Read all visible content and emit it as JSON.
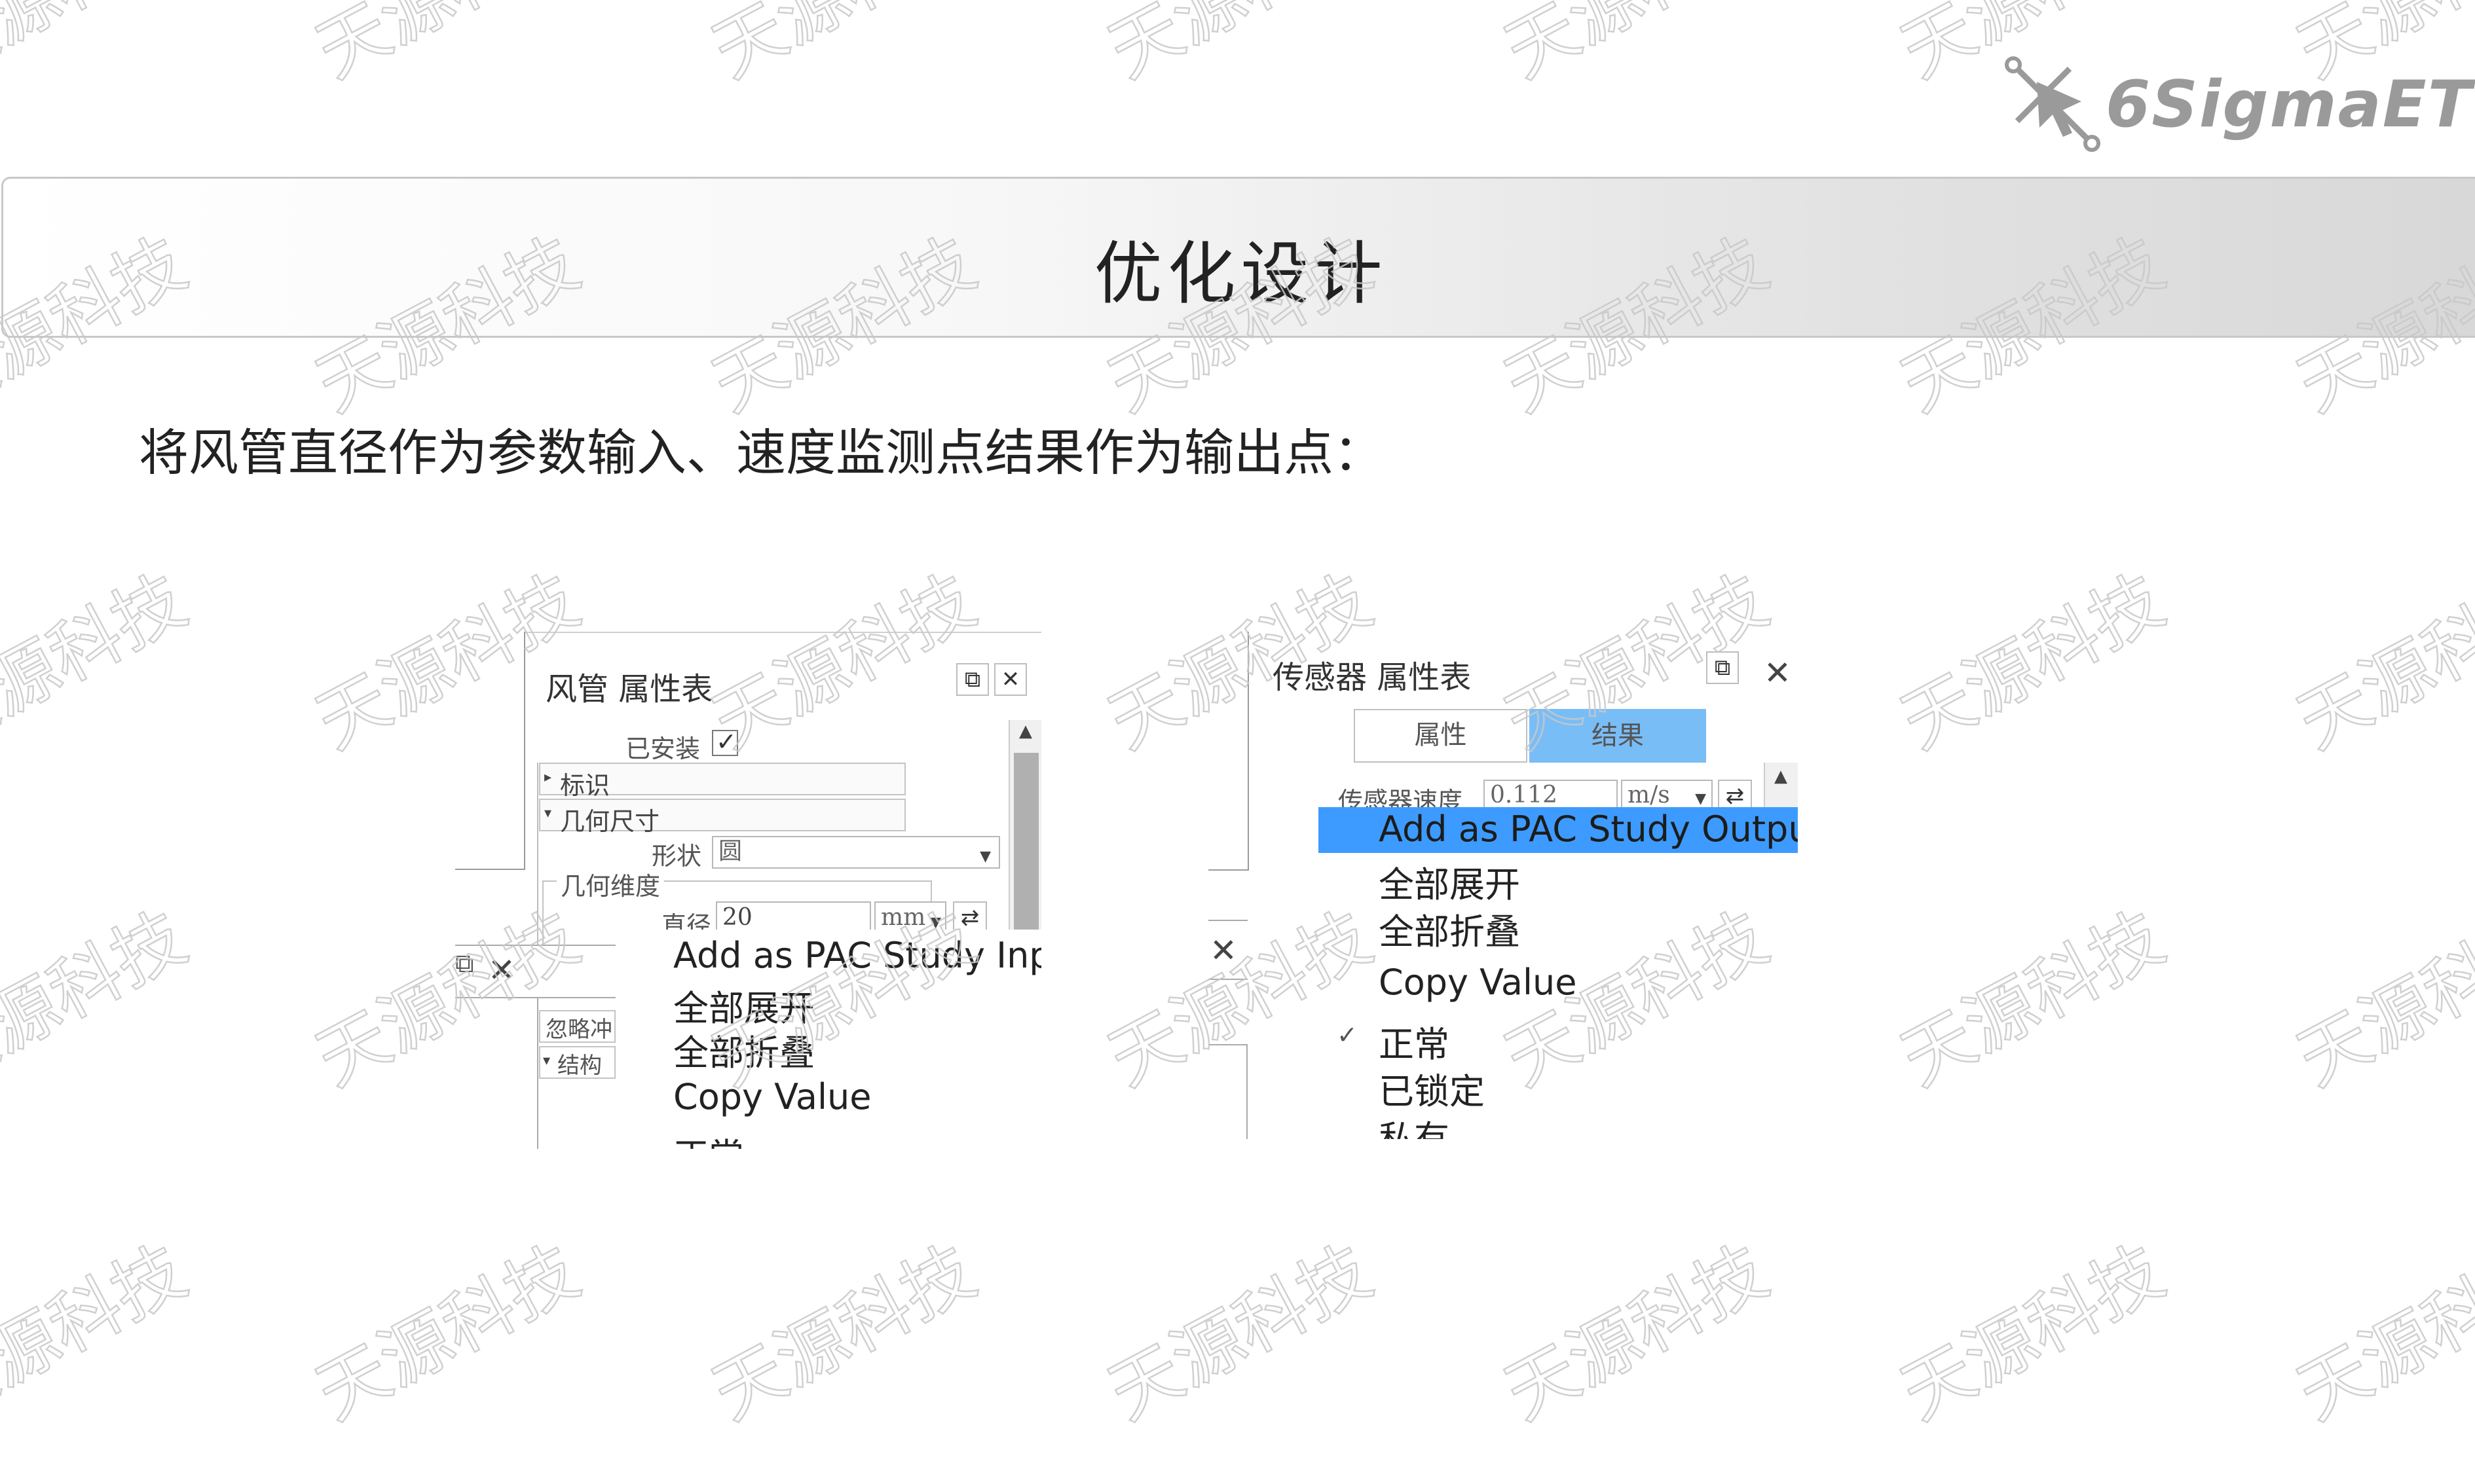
{
  "watermark": {
    "text": "天源科技",
    "color": "#c8c8c8"
  },
  "logo": {
    "text": "6SigmaET",
    "color": "#9a9a9a"
  },
  "banner": {
    "title": "优化设计"
  },
  "intro": "将风管直径作为参数输入、速度监测点结果作为输出点：",
  "left_panel": {
    "title": "风管 属性表",
    "restore_icon": "⧉",
    "close_icon": "✕",
    "installed_label": "已安装",
    "installed_checked": true,
    "sections": {
      "identity": "标识",
      "geometry": "几何尺寸",
      "structure": "结构"
    },
    "shape_label": "形状",
    "shape_value": "圆",
    "dimension_group": "几何维度",
    "diameter_label": "直径",
    "diameter_value": "20",
    "diameter_unit": "mm",
    "swap_icon": "⇄",
    "ignore_label": "忽略冲",
    "context_menu": [
      "Add as PAC Study Input",
      "全部展开",
      "全部折叠",
      "Copy Value",
      "正常"
    ]
  },
  "right_panel": {
    "title": "传感器 属性表",
    "restore_icon": "⧉",
    "close_icon": "✕",
    "tabs": [
      {
        "label": "属性",
        "active": false
      },
      {
        "label": "结果",
        "active": true
      }
    ],
    "sensor_speed_label": "传感器速度",
    "sensor_speed_value": "0.112",
    "sensor_speed_unit": "m/s",
    "swap_icon": "⇄",
    "context_menu": {
      "highlighted": "Add as PAC Study Output",
      "highlight_color": "#3d9bff",
      "items": [
        "全部展开",
        "全部折叠",
        "Copy Value",
        "正常",
        "已锁定",
        "私有"
      ],
      "checked_item": "正常"
    }
  }
}
